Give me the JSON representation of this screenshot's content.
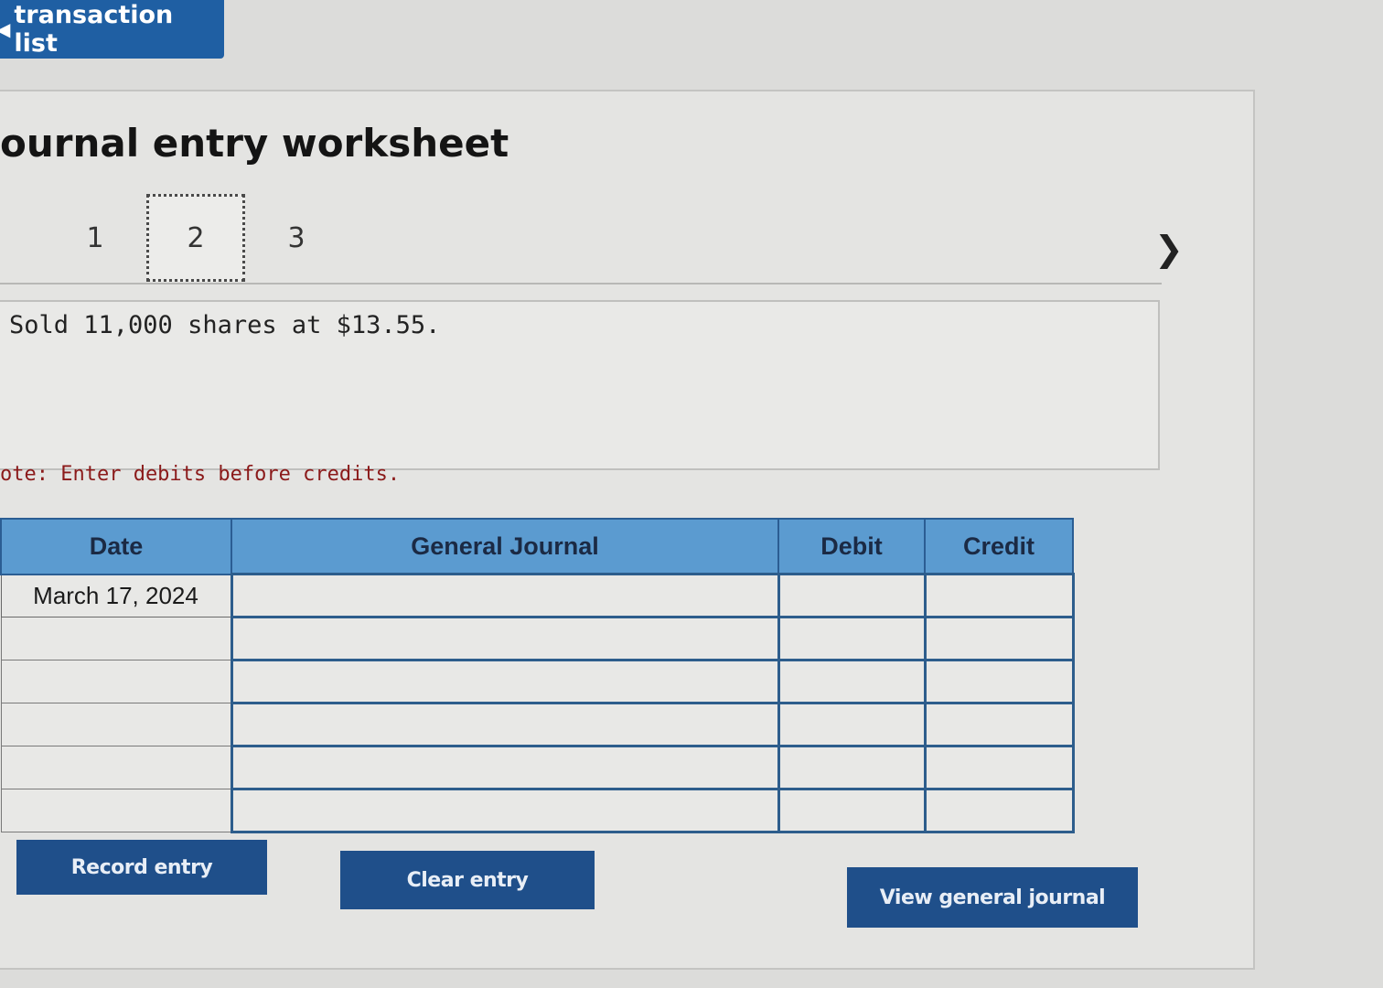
{
  "top_button": {
    "label": "transaction list",
    "icon": "arrow-left-icon"
  },
  "title": "ournal entry worksheet",
  "tabs": [
    {
      "label": "1"
    },
    {
      "label": "2"
    },
    {
      "label": "3"
    }
  ],
  "active_tab": "2",
  "next_icon": "chevron-right-icon",
  "description": "Sold 11,000 shares at $13.55.",
  "note": "ote: Enter debits before credits.",
  "table": {
    "headers": {
      "date": "Date",
      "general_journal": "General Journal",
      "debit": "Debit",
      "credit": "Credit"
    },
    "rows": [
      {
        "date": "March 17, 2024",
        "account": "",
        "debit": "",
        "credit": ""
      },
      {
        "date": "",
        "account": "",
        "debit": "",
        "credit": ""
      },
      {
        "date": "",
        "account": "",
        "debit": "",
        "credit": ""
      },
      {
        "date": "",
        "account": "",
        "debit": "",
        "credit": ""
      },
      {
        "date": "",
        "account": "",
        "debit": "",
        "credit": ""
      },
      {
        "date": "",
        "account": "",
        "debit": "",
        "credit": ""
      }
    ]
  },
  "buttons": {
    "record": "Record entry",
    "clear": "Clear entry",
    "view": "View general journal"
  },
  "colors": {
    "button_blue": "#1f4f8a",
    "header_blue": "#5b9bd0",
    "note_red": "#8b1a1a"
  }
}
